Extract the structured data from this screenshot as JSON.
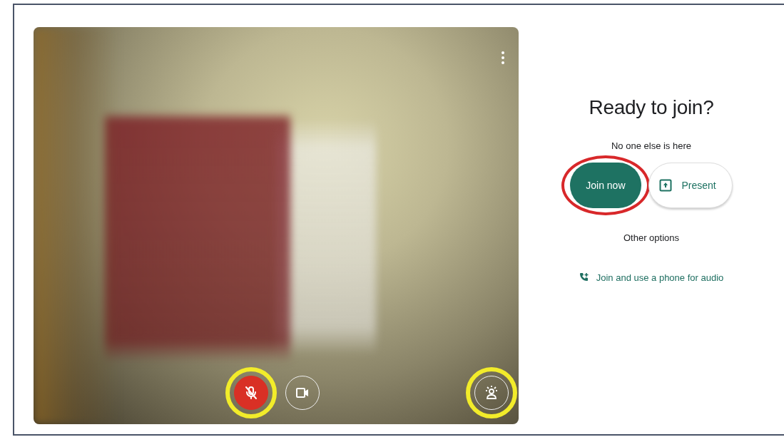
{
  "preview": {
    "controls": [
      {
        "kind": "mic",
        "muted": true,
        "annotation": {
          "color": "#f2ec2a"
        }
      },
      {
        "kind": "camera",
        "muted": false
      },
      {
        "kind": "effects",
        "annotation": {
          "color": "#f2ec2a"
        }
      }
    ]
  },
  "join_panel": {
    "heading": "Ready to join?",
    "status": "No one else is here",
    "buttons": [
      {
        "kind": "primary",
        "label": "Join now",
        "annotation": {
          "color": "#d8282a"
        }
      },
      {
        "kind": "present",
        "label": "Present"
      }
    ],
    "other_options": "Other options",
    "phone_option": "Join and use a phone for audio"
  }
}
